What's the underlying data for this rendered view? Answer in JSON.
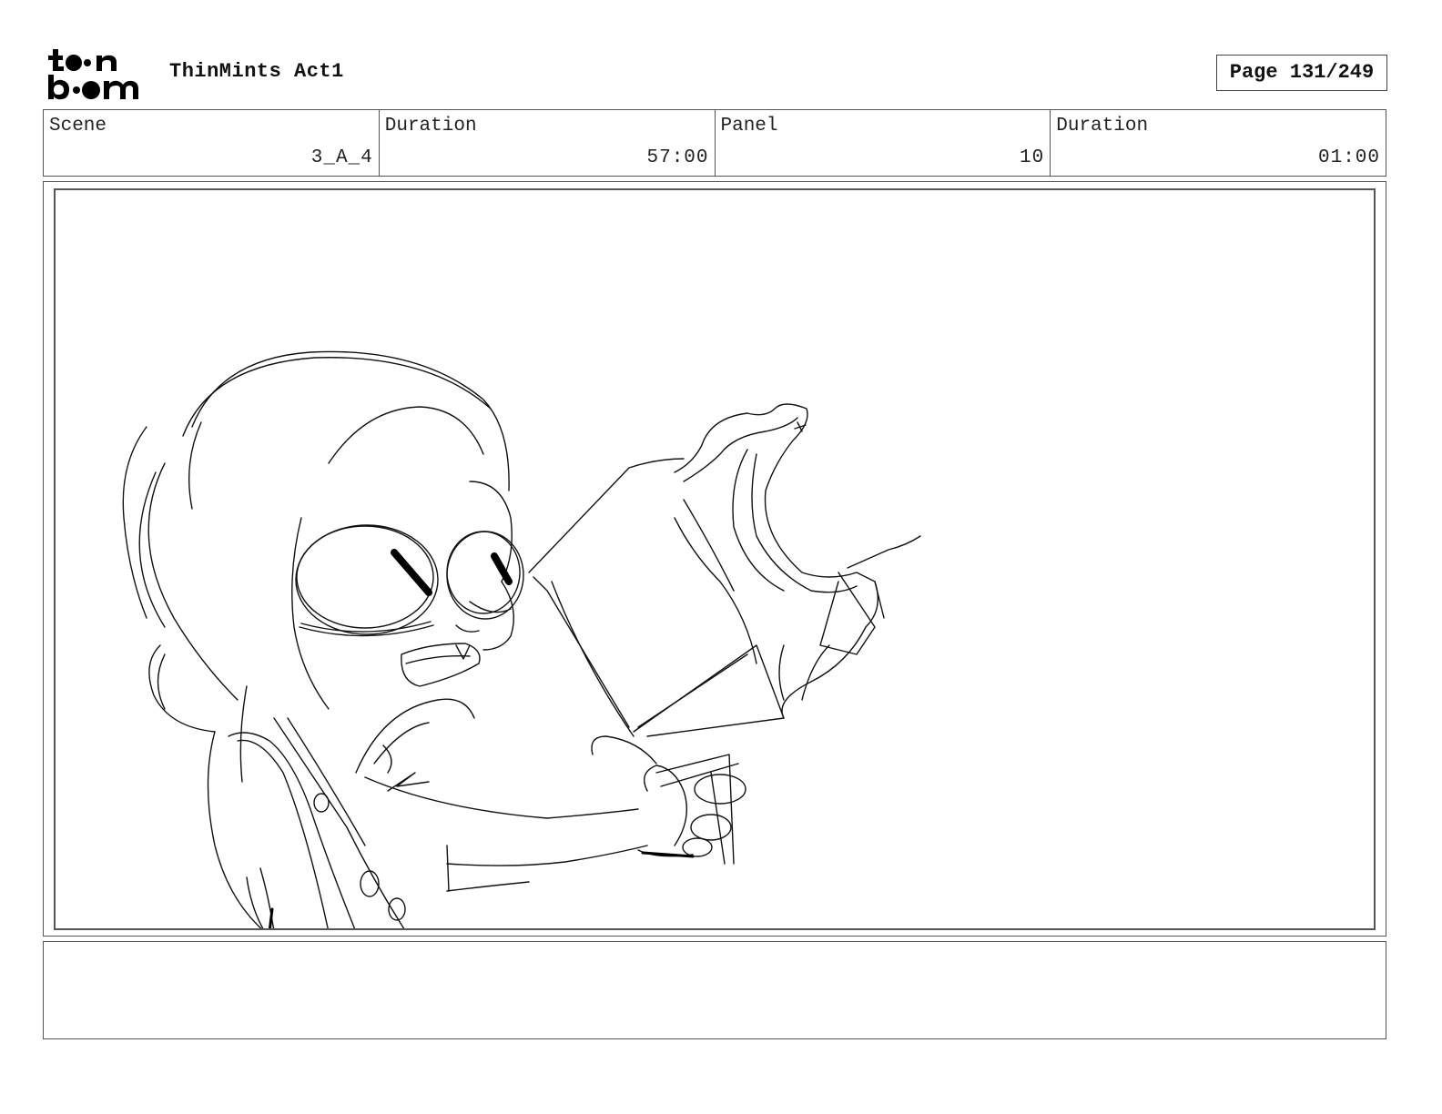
{
  "header": {
    "logo_alt": "toon boom",
    "project_title": "ThinMints Act1",
    "page_label": "Page 131/249"
  },
  "info": {
    "scene_label": "Scene",
    "scene_value": "3_A_4",
    "scene_duration_label": "Duration",
    "scene_duration_value": "57:00",
    "panel_label": "Panel",
    "panel_value": "10",
    "panel_duration_label": "Duration",
    "panel_duration_value": "01:00"
  },
  "panel": {
    "image_subject": "sketch-girl-eating-cookie"
  },
  "notes": {
    "text": ""
  }
}
